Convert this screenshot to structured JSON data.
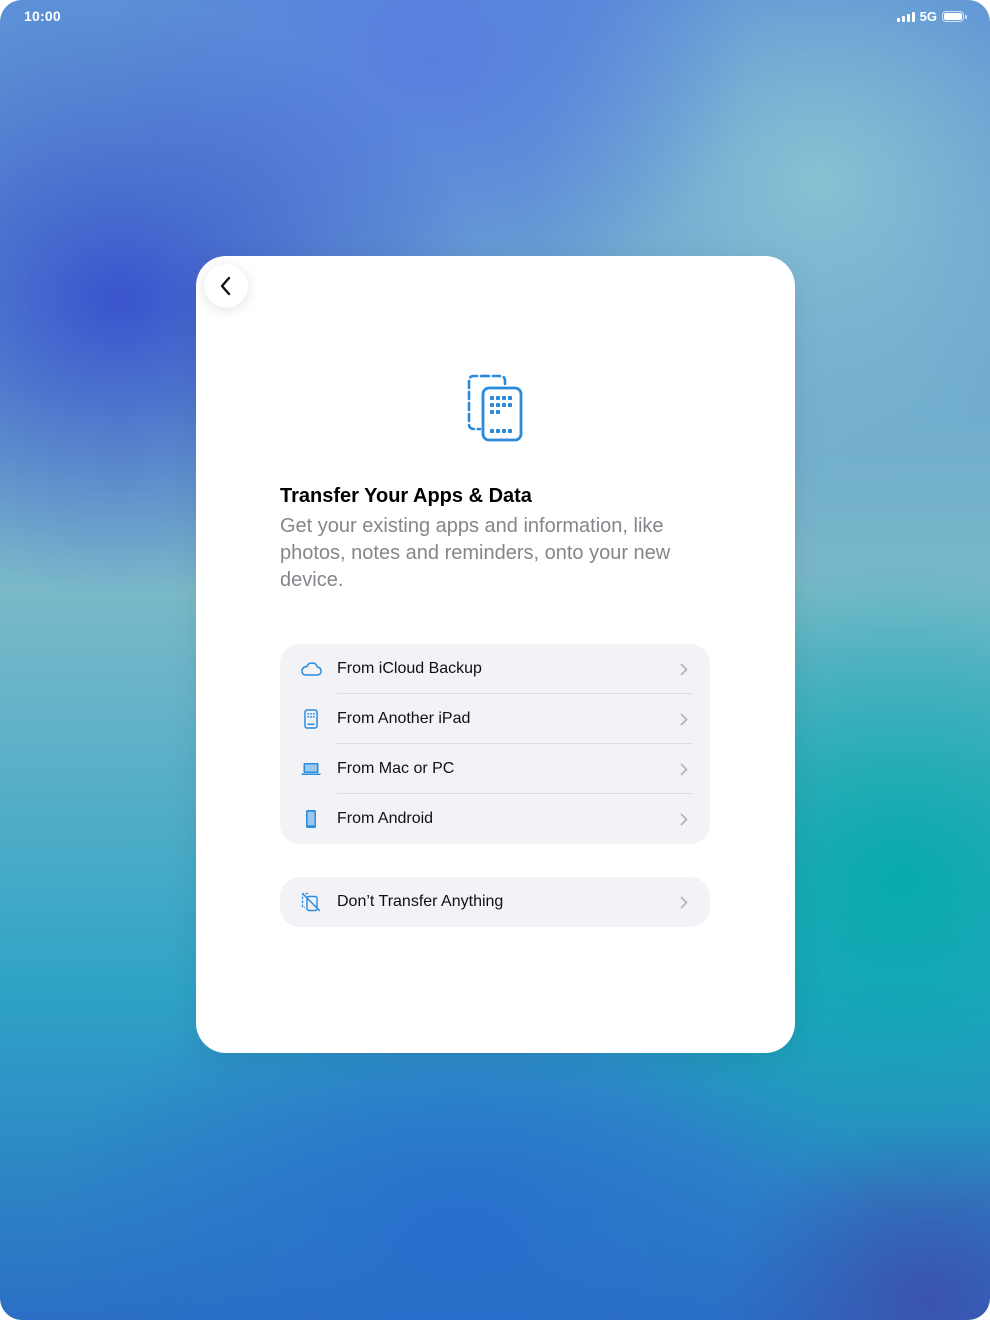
{
  "status_bar": {
    "time": "10:00",
    "network": "5G"
  },
  "colors": {
    "accent": "#2a8bdc",
    "card_background": "#ffffff",
    "group_background": "#f2f2f7",
    "subtitle": "#85858b"
  },
  "header": {
    "back_icon": "chevron-left-icon",
    "hero_icon": "transfer-devices-icon"
  },
  "main": {
    "title": "Transfer Your Apps & Data",
    "subtitle": "Get your existing apps and information, like photos, notes and reminders, onto your new device."
  },
  "options": [
    {
      "label": "From iCloud Backup",
      "icon": "cloud-icon"
    },
    {
      "label": "From Another iPad",
      "icon": "ipad-icon"
    },
    {
      "label": "From Mac or PC",
      "icon": "laptop-icon"
    },
    {
      "label": "From Android",
      "icon": "phone-icon"
    }
  ],
  "skip_option": {
    "label": "Don’t Transfer Anything",
    "icon": "no-transfer-icon"
  }
}
